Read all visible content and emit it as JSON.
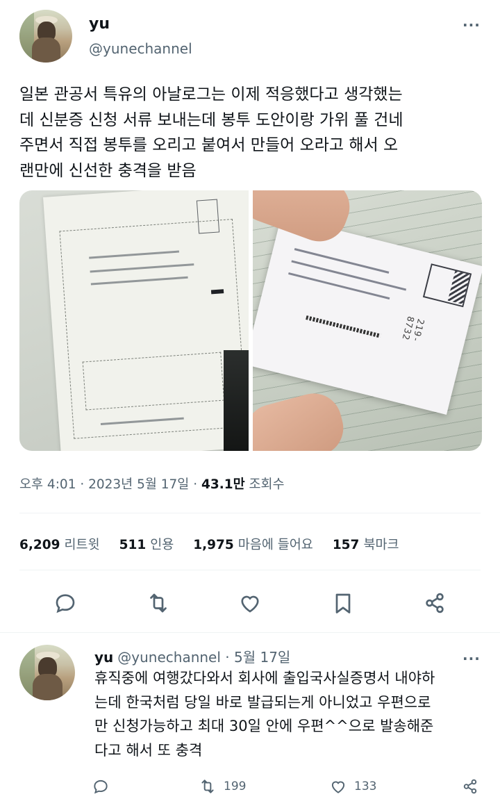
{
  "tweet": {
    "author_name": "yu",
    "author_handle": "@yunechannel",
    "more_label": "···",
    "text": "일본 관공서 특유의 아날로그는 이제 적응했다고 생각했는\n데 신분증 신청 서류 보내는데 봉투 도안이랑 가위 풀 건네\n주면서 직접 봉투를 오리고 붙여서 만들어 오라고 해서 오\n랜만에 신선한 충격을 받음",
    "timestamp": "오후 4:01 · 2023년 5월 17일 · ",
    "views_count": "43.1만",
    "views_label": " 조회수",
    "stats": {
      "retweets_count": "6,209",
      "retweets_label": "리트윗",
      "quotes_count": "511",
      "quotes_label": "인용",
      "likes_count": "1,975",
      "likes_label": "마음에 들어요",
      "bookmarks_count": "157",
      "bookmarks_label": "북마크"
    },
    "photo_right_number": "219-8732"
  },
  "reply": {
    "author_name": "yu",
    "author_handle": "@yunechannel",
    "date": " · 5월 17일",
    "more_label": "···",
    "text": "휴직중에 여행갔다와서 회사에 출입국사실증명서 내야하\n는데 한국처럼 당일 바로 발급되는게 아니었고 우편으로\n만 신청가능하고 최대 30일 안에 우편^^으로 발송해준\n다고 해서 또 충격",
    "retweets_count": "199",
    "likes_count": "133"
  },
  "icons": {
    "reply": "speech-bubble-icon",
    "retweet": "retweet-icon",
    "like": "heart-icon",
    "bookmark": "bookmark-icon",
    "share": "share-icon",
    "more": "more-dots-icon"
  },
  "colors": {
    "text_primary": "#0f1419",
    "text_secondary": "#536471",
    "divider": "#eff3f4"
  }
}
